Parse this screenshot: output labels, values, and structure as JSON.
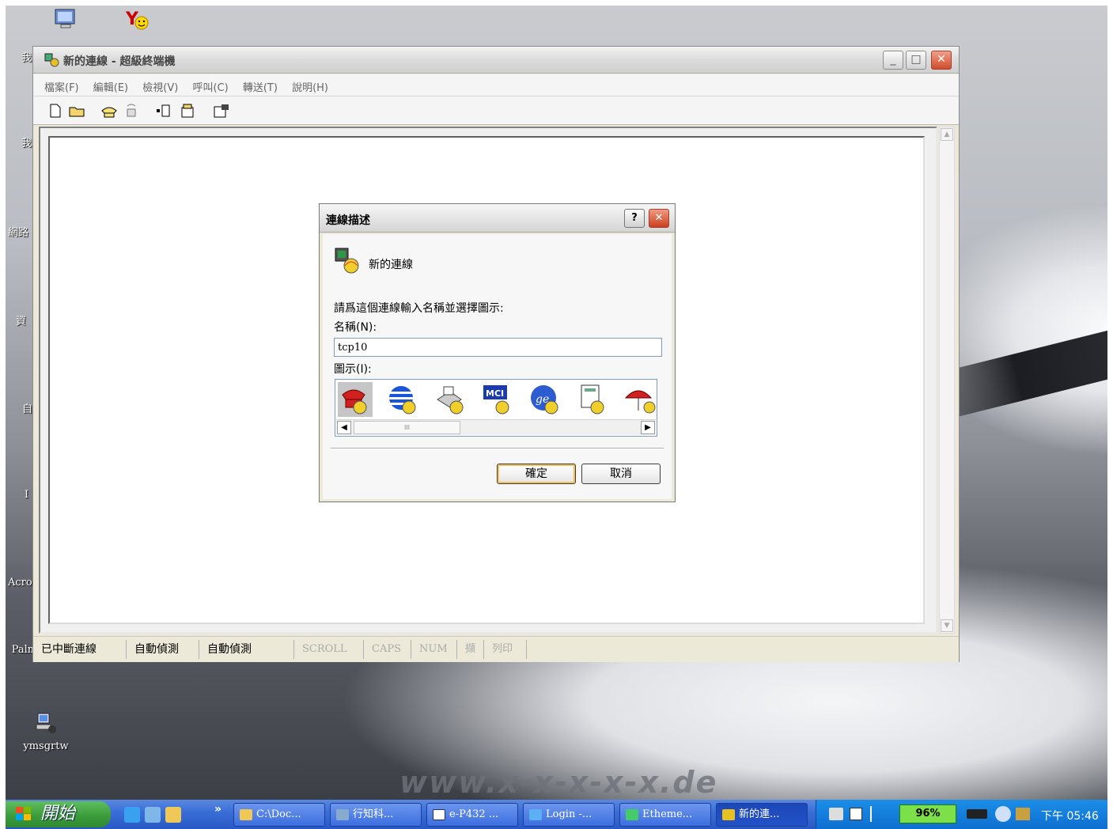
{
  "main_window": {
    "title": "新的連線 - 超級終端機",
    "menu": [
      "檔案(F)",
      "編輯(E)",
      "檢視(V)",
      "呼叫(C)",
      "轉送(T)",
      "說明(H)"
    ],
    "status": {
      "connection": "已中斷連線",
      "detect1": "自動偵測",
      "detect2": "自動偵測",
      "scroll": "SCROLL",
      "caps": "CAPS",
      "num": "NUM",
      "capture": "擷",
      "print": "列印"
    }
  },
  "dialog": {
    "title": "連線描述",
    "help": "?",
    "connection_label": "新的連線",
    "instruction": "請爲這個連線輸入名稱並選擇圖示:",
    "name_label": "名稱(N):",
    "name_value": "tcp10",
    "icon_label": "圖示(I):",
    "scroll_thumb": "III",
    "ok": "確定",
    "cancel": "取消"
  },
  "desktop": {
    "icons": [
      {
        "label": "Palm Desktop"
      },
      {
        "label": "ymsgrtw"
      }
    ],
    "fragments": [
      "我",
      "我",
      "網路",
      "資",
      "自",
      "I",
      "Acro"
    ],
    "watermark": "www.x-x-x-x-x.de"
  },
  "taskbar": {
    "start": "開始",
    "chevron": "»",
    "tasks": [
      "C:\\Doc...",
      "行知科...",
      "e-P432 ...",
      "Login -...",
      "Etheme...",
      "新的連..."
    ],
    "battery": "96%",
    "clock": "下午 05:46"
  }
}
